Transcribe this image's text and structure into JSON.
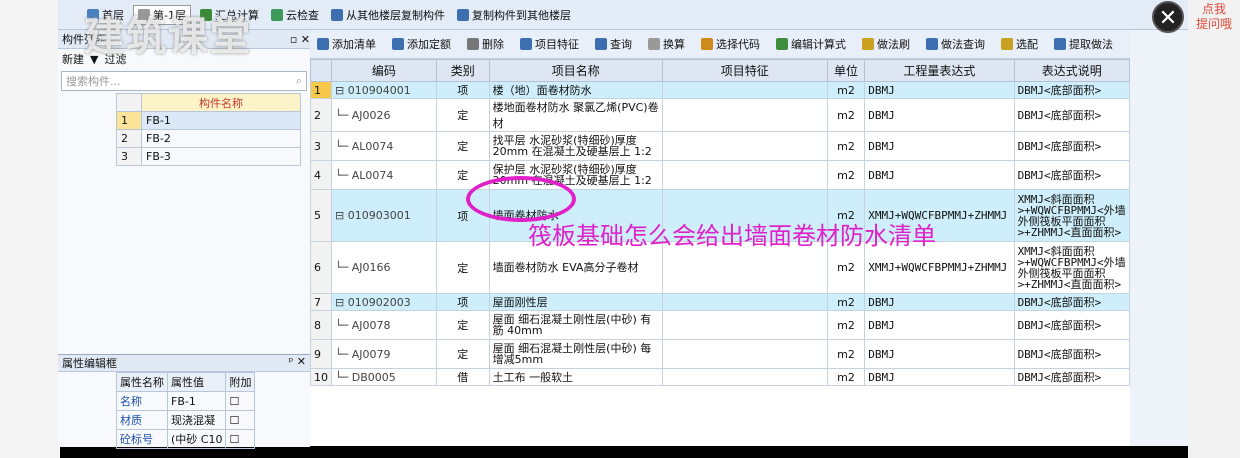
{
  "top_toolbar": {
    "items": [
      "首层",
      "第-1层",
      "汇总计算",
      "云检查",
      "从其他楼层复制构件",
      "复制构件到其他楼层"
    ]
  },
  "close_label": "✕",
  "tip_badge": "点我\n提问哦",
  "watermark": "建筑课堂",
  "left_panel": {
    "title": "构件列表",
    "tools": [
      "新建",
      "▼",
      "过滤"
    ],
    "search_placeholder": "搜索构件...",
    "col_header": "构件名称",
    "rows": [
      {
        "num": "1",
        "name": "FB-1"
      },
      {
        "num": "2",
        "name": "FB-2"
      },
      {
        "num": "3",
        "name": "FB-3"
      }
    ]
  },
  "prop_panel": {
    "title": "属性编辑框",
    "headers": [
      "属性名称",
      "属性值",
      "附加"
    ],
    "rows": [
      {
        "name": "名称",
        "value": "FB-1"
      },
      {
        "name": "材质",
        "value": "现浇混凝"
      },
      {
        "name": "砼标号",
        "value": "(中砂 C10"
      }
    ]
  },
  "main_toolbar": {
    "items": [
      "添加清单",
      "添加定额",
      "删除",
      "项目特征",
      "查询",
      "换算",
      "选择代码",
      "编辑计算式",
      "做法刷",
      "做法查询",
      "选配",
      "提取做法"
    ]
  },
  "table": {
    "headers": [
      "",
      "编码",
      "类别",
      "项目名称",
      "项目特征",
      "单位",
      "工程量表达式",
      "表达式说明"
    ],
    "rows": [
      {
        "idx": "1",
        "code": "010904001",
        "type": "项",
        "name": "楼（地）面卷材防水",
        "feature": "",
        "unit": "m2",
        "expr": "DBMJ",
        "desc": "DBMJ<底部面积>",
        "kind": "xiang",
        "h": 17
      },
      {
        "idx": "2",
        "code": "AJ0026",
        "type": "定",
        "name": "楼地面卷材防水 聚氯乙烯(PVC)卷材",
        "feature": "",
        "unit": "m2",
        "expr": "DBMJ",
        "desc": "DBMJ<底部面积>",
        "kind": "ding",
        "h": 17
      },
      {
        "idx": "3",
        "code": "AL0074",
        "type": "定",
        "name": "找平层 水泥砂浆(特细砂)厚度20mm 在混凝土及硬基层上 1:2",
        "feature": "",
        "unit": "m2",
        "expr": "DBMJ",
        "desc": "DBMJ<底部面积>",
        "kind": "ding",
        "h": 29
      },
      {
        "idx": "4",
        "code": "AL0074",
        "type": "定",
        "name": "保护层 水泥砂浆(特细砂)厚度20mm 在混凝土及硬基层上 1:2",
        "feature": "",
        "unit": "m2",
        "expr": "DBMJ",
        "desc": "DBMJ<底部面积>",
        "kind": "ding",
        "h": 29
      },
      {
        "idx": "5",
        "code": "010903001",
        "type": "项",
        "name": "墙面卷材防水",
        "feature": "",
        "unit": "m2",
        "expr": "XMMJ+WQWCFBPMMJ+ZHMMJ",
        "desc": "XMMJ<斜面面积>+WQWCFBPMMJ<外墙外侧筏板平面面积>+ZHMMJ<直面面积>",
        "kind": "xiang",
        "h": 52
      },
      {
        "idx": "6",
        "code": "AJ0166",
        "type": "定",
        "name": "墙面卷材防水 EVA高分子卷材",
        "feature": "",
        "unit": "m2",
        "expr": "XMMJ+WQWCFBPMMJ+ZHMMJ",
        "desc": "XMMJ<斜面面积>+WQWCFBPMMJ<外墙外侧筏板平面面积>+ZHMMJ<直面面积>",
        "kind": "ding",
        "h": 52
      },
      {
        "idx": "7",
        "code": "010902003",
        "type": "项",
        "name": "屋面刚性层",
        "feature": "",
        "unit": "m2",
        "expr": "DBMJ",
        "desc": "DBMJ<底部面积>",
        "kind": "xiang",
        "h": 17
      },
      {
        "idx": "8",
        "code": "AJ0078",
        "type": "定",
        "name": "屋面 细石混凝土刚性层(中砂) 有筋 40mm",
        "feature": "",
        "unit": "m2",
        "expr": "DBMJ",
        "desc": "DBMJ<底部面积>",
        "kind": "ding",
        "h": 29
      },
      {
        "idx": "9",
        "code": "AJ0079",
        "type": "定",
        "name": "屋面 细石混凝土刚性层(中砂) 每增减5mm",
        "feature": "",
        "unit": "m2",
        "expr": "DBMJ",
        "desc": "DBMJ<底部面积>",
        "kind": "ding",
        "h": 29
      },
      {
        "idx": "10",
        "code": "DB0005",
        "type": "借",
        "name": "土工布 一般软土",
        "feature": "",
        "unit": "m2",
        "expr": "DBMJ",
        "desc": "DBMJ<底部面积>",
        "kind": "ding",
        "h": 17
      }
    ]
  },
  "annotation": "筏板基础怎么会给出墙面卷材防水清单",
  "colors": {
    "annotation": "#e020c8",
    "xiang_row": "#cdeefa",
    "header": "#dde6f2"
  }
}
